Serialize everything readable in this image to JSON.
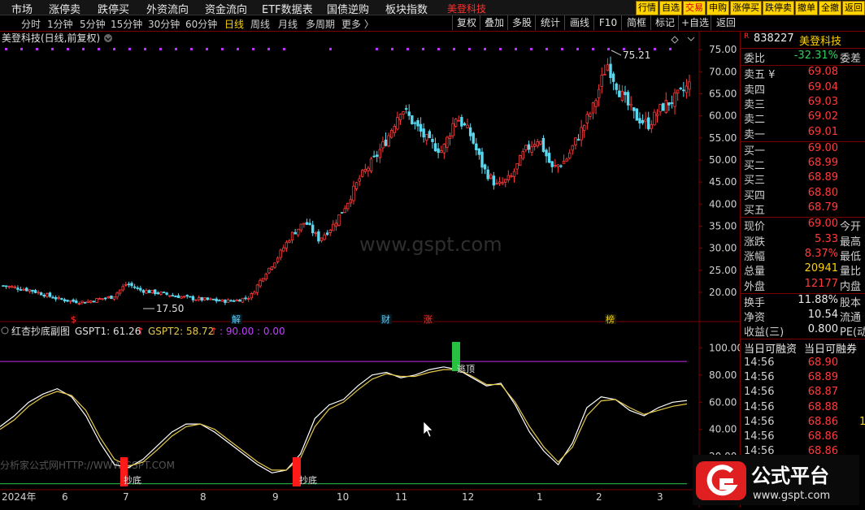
{
  "menubar": {
    "items": [
      "市场",
      "涨停卖",
      "跌停买",
      "外资流向",
      "资金流向",
      "ETF数据表",
      "国债逆购",
      "板块指数"
    ],
    "stock_name": "美登科技",
    "right_buttons": [
      {
        "label": "行情",
        "color": "#ffd200"
      },
      {
        "label": "自选",
        "color": "#ffd200"
      },
      {
        "label": "交易",
        "color": "#ffd200"
      },
      {
        "label": "申购",
        "color": "#ffd200"
      },
      {
        "label": "涨停买",
        "color": "#ffd200"
      },
      {
        "label": "跌停卖",
        "color": "#ffd200"
      },
      {
        "label": "撤单",
        "color": "#ffd200"
      },
      {
        "label": "全撤",
        "color": "#ffd200"
      },
      {
        "label": "返回",
        "color": "#ffd200"
      }
    ]
  },
  "toolbar": {
    "periods": [
      "分时",
      "1分钟",
      "5分钟",
      "15分钟",
      "30分钟",
      "60分钟",
      "日线",
      "周线",
      "月线",
      "多周期",
      "更多 〉"
    ],
    "active_period": "日线",
    "buttons": [
      "复权",
      "叠加",
      "多股",
      "统计",
      "画线",
      "F10",
      "简框",
      "标记",
      "+自选",
      "返回"
    ]
  },
  "main_chart": {
    "title": "美登科技(日线,前复权)",
    "high_label": "75.21",
    "low_label": "17.50",
    "watermark": "www.gspt.com",
    "event_markers": [
      {
        "label": "$",
        "color": "#ff3030"
      },
      {
        "label": "解",
        "color": "#60d0ff"
      },
      {
        "label": "财",
        "color": "#60d0ff"
      },
      {
        "label": "涨",
        "color": "#ff3030"
      },
      {
        "label": "榜",
        "color": "#ffd200"
      }
    ]
  },
  "indicator": {
    "title": "红杏抄底副图",
    "gspt1_label": "GSPT1: 61.26",
    "gspt2_label": "GSPT2: 58.72",
    "extra": ": 90.00 : 0.00",
    "mark_bottom": "抄底",
    "mark_top": "逃顶",
    "watermark": "分析家公式网HTTP://WWW.GSPT.COM"
  },
  "axis": {
    "x_labels": [
      "2024年",
      "6",
      "7",
      "8",
      "9",
      "10",
      "11",
      "12",
      "1",
      "2",
      "3"
    ]
  },
  "chart_data": [
    {
      "type": "candlestick",
      "title": "美登科技(日线,前复权)",
      "y_ticks": [
        20.0,
        25.0,
        30.0,
        35.0,
        40.0,
        45.0,
        50.0,
        55.0,
        60.0,
        65.0,
        70.0,
        75.0
      ],
      "ylim": [
        16.5,
        76.5
      ],
      "high": 75.21,
      "low": 17.5,
      "x": [
        "2024-05",
        "2024-06",
        "2024-07",
        "2024-08",
        "2024-09",
        "2024-10",
        "2024-11",
        "2024-12",
        "2025-01",
        "2025-02",
        "2025-03"
      ],
      "close_path": [
        21.5,
        21.0,
        20.5,
        19.5,
        18.5,
        18.0,
        17.8,
        18.5,
        19.0,
        22.0,
        20.5,
        20.0,
        19.5,
        19.0,
        18.5,
        18.3,
        18.0,
        18.2,
        19.0,
        24.0,
        28.0,
        33.0,
        36.0,
        32.0,
        35.0,
        40.0,
        46.0,
        50.0,
        55.0,
        62.0,
        58.0,
        54.0,
        52.0,
        60.0,
        56.0,
        48.0,
        44.0,
        46.0,
        52.0,
        55.0,
        48.0,
        50.0,
        56.0,
        62.0,
        72.0,
        65.0,
        60.0,
        58.0,
        62.0,
        64.0,
        67.0
      ]
    },
    {
      "type": "line",
      "title": "红杏抄底副图",
      "y_ticks": [
        20.0,
        40.0,
        60.0,
        80.0,
        100.0
      ],
      "ylim": [
        -2,
        108
      ],
      "reference_lines": [
        90.0,
        0.0
      ],
      "series": [
        {
          "name": "GSPT1",
          "color": "#ffffff",
          "last": 61.26,
          "values": [
            42,
            50,
            60,
            66,
            70,
            64,
            50,
            30,
            14,
            12,
            18,
            28,
            38,
            44,
            44,
            38,
            30,
            22,
            14,
            8,
            10,
            22,
            48,
            58,
            62,
            72,
            80,
            82,
            78,
            80,
            84,
            86,
            84,
            78,
            72,
            74,
            58,
            38,
            24,
            14,
            30,
            56,
            64,
            62,
            54,
            50,
            56,
            60,
            61.26
          ]
        },
        {
          "name": "GSPT2",
          "color": "#e6c84a",
          "last": 58.72,
          "values": [
            40,
            47,
            57,
            64,
            68,
            65,
            54,
            34,
            18,
            13,
            16,
            25,
            35,
            42,
            44,
            40,
            32,
            24,
            16,
            10,
            10,
            19,
            42,
            55,
            60,
            69,
            77,
            81,
            79,
            79,
            82,
            84,
            84,
            79,
            73,
            73,
            60,
            42,
            27,
            16,
            27,
            50,
            61,
            62,
            56,
            51,
            54,
            57,
            58.72
          ]
        }
      ]
    }
  ],
  "quote": {
    "code": "838227",
    "name": "美登科技",
    "rows": [
      {
        "label": "委比",
        "value": "-32.31%",
        "vclass": "green",
        "label2": "委差"
      },
      {
        "label": "卖五 ¥",
        "value": "69.08",
        "vclass": "red",
        "label2": ""
      },
      {
        "label": "卖四",
        "value": "69.04",
        "vclass": "red",
        "label2": ""
      },
      {
        "label": "卖三",
        "value": "69.03",
        "vclass": "red",
        "label2": ""
      },
      {
        "label": "卖二",
        "value": "69.02",
        "vclass": "red",
        "label2": ""
      },
      {
        "label": "卖一",
        "value": "69.01",
        "vclass": "red",
        "label2": ""
      },
      {
        "label": "买一",
        "value": "69.00",
        "vclass": "red",
        "label2": ""
      },
      {
        "label": "买二",
        "value": "68.99",
        "vclass": "red",
        "label2": ""
      },
      {
        "label": "买三",
        "value": "68.89",
        "vclass": "red",
        "label2": ""
      },
      {
        "label": "买四",
        "value": "68.80",
        "vclass": "red",
        "label2": ""
      },
      {
        "label": "买五",
        "value": "68.79",
        "vclass": "red",
        "label2": ""
      },
      {
        "label": "现价",
        "value": "69.00",
        "vclass": "red",
        "label2": "今开"
      },
      {
        "label": "涨跌",
        "value": "5.33",
        "vclass": "red",
        "label2": "最高"
      },
      {
        "label": "涨幅",
        "value": "8.37%",
        "vclass": "red",
        "label2": "最低"
      },
      {
        "label": "总量",
        "value": "20941",
        "vclass": "yellow",
        "label2": "量比"
      },
      {
        "label": "外盘",
        "value": "12177",
        "vclass": "red",
        "label2": "内盘"
      },
      {
        "label": "换手",
        "value": "11.88%",
        "vclass": "white",
        "label2": "股本"
      },
      {
        "label": "净资",
        "value": "10.54",
        "vclass": "white",
        "label2": "流通"
      },
      {
        "label": "收益(三)",
        "value": "0.800",
        "vclass": "white",
        "label2": "PE(动"
      }
    ],
    "ticks_header": [
      "当日可融资",
      "当日可融券"
    ],
    "ticks": [
      {
        "time": "14:56",
        "price": "68.90",
        "extra": ""
      },
      {
        "time": "14:56",
        "price": "68.89",
        "extra": ""
      },
      {
        "time": "14:56",
        "price": "68.87",
        "extra": ""
      },
      {
        "time": "14:56",
        "price": "68.88",
        "extra": ""
      },
      {
        "time": "14:56",
        "price": "68.86",
        "extra": "1"
      },
      {
        "time": "14:56",
        "price": "68.86",
        "extra": ""
      },
      {
        "time": "14:56",
        "price": "68.86",
        "extra": ""
      }
    ]
  },
  "logo": {
    "text": "公式平台",
    "url": "www.gspt.com"
  }
}
